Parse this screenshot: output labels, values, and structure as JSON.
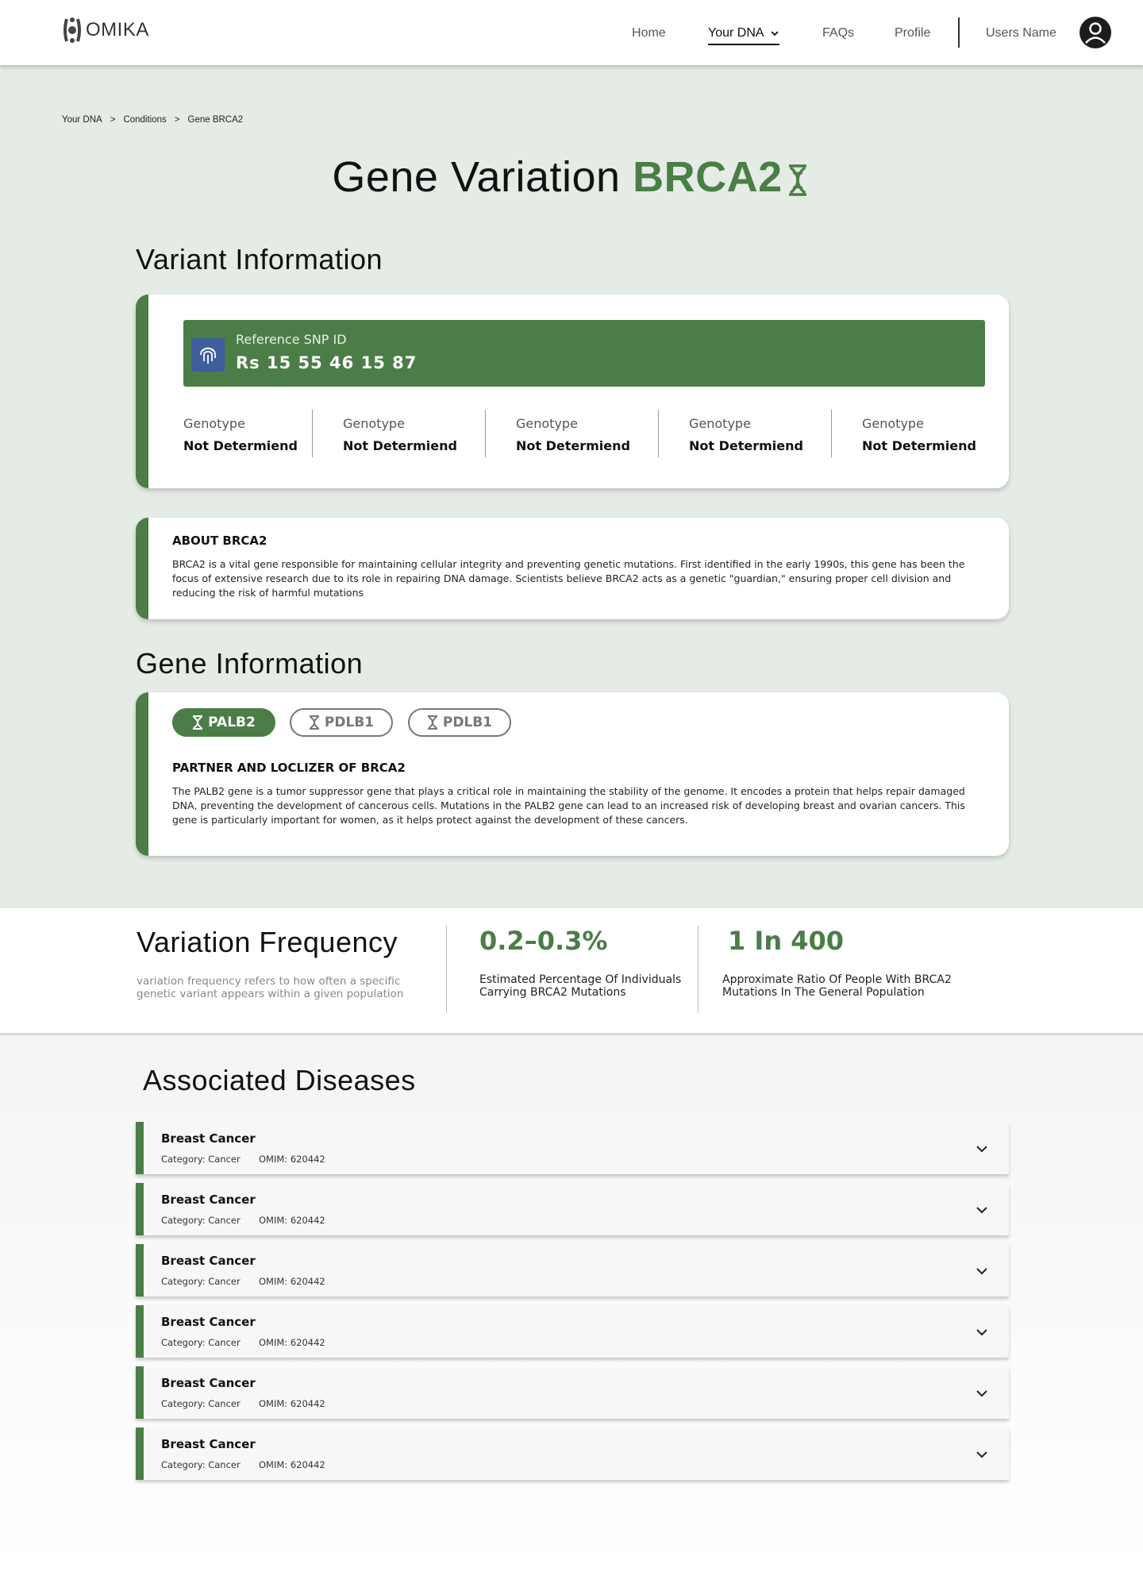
{
  "header": {
    "logo_text": "OMIKA",
    "nav": {
      "home": "Home",
      "your_dna": "Your DNA",
      "faqs": "FAQs",
      "profile": "Profile",
      "user_name": "Users Name"
    }
  },
  "breadcrumb": [
    "Your DNA",
    ">",
    "Conditions",
    ">",
    "Gene BRCA2"
  ],
  "title": {
    "prefix": "Gene Variation",
    "gene": "BRCA2"
  },
  "variant": {
    "heading": "Variant Information",
    "snp_label": "Reference SNP ID",
    "snp_value": "Rs 15 55 46 15 87",
    "genotypes": [
      {
        "label": "Genotype",
        "value": "Not Determiend"
      },
      {
        "label": "Genotype",
        "value": "Not Determiend"
      },
      {
        "label": "Genotype",
        "value": "Not Determiend"
      },
      {
        "label": "Genotype",
        "value": "Not Determiend"
      },
      {
        "label": "Genotype",
        "value": "Not Determiend"
      }
    ]
  },
  "about": {
    "title": "ABOUT BRCA2",
    "text": "BRCA2 is a vital gene responsible for maintaining cellular integrity and preventing genetic mutations. First identified in the early 1990s, this gene has been the focus of extensive research due to its role in repairing DNA damage. Scientists believe BRCA2 acts as a genetic \"guardian,\" ensuring proper cell division and reducing the risk of harmful mutations"
  },
  "gene_info": {
    "heading": "Gene Information",
    "tabs": [
      "PALB2",
      "PDLB1",
      "PDLB1"
    ],
    "active_tab": "PALB2",
    "title": "PARTNER AND LOCLIZER OF BRCA2",
    "text": "The PALB2 gene is a tumor suppressor gene that plays a critical role in maintaining the stability of the genome. It encodes a protein that helps repair damaged DNA, preventing the development of cancerous cells. Mutations in the PALB2 gene can lead to an increased risk of developing breast and ovarian cancers. This gene is particularly important for women, as it helps protect against the development of these cancers."
  },
  "frequency": {
    "heading": "Variation Frequency",
    "description": "variation frequency refers to how often a specific genetic variant appears within a given population",
    "stat1_value": "0.2–0.3%",
    "stat1_label": "Estimated Percentage Of Individuals Carrying BRCA2 Mutations",
    "stat2_value": "1 In 400",
    "stat2_label": "Approximate Ratio Of People With BRCA2 Mutations In The General Population"
  },
  "diseases": {
    "heading": "Associated Diseases",
    "items": [
      {
        "name": "Breast Cancer",
        "category": "Category: Cancer",
        "omim": "OMIM: 620442"
      },
      {
        "name": "Breast Cancer",
        "category": "Category: Cancer",
        "omim": "OMIM: 620442"
      },
      {
        "name": "Breast Cancer",
        "category": "Category: Cancer",
        "omim": "OMIM: 620442"
      },
      {
        "name": "Breast Cancer",
        "category": "Category: Cancer",
        "omim": "OMIM: 620442"
      },
      {
        "name": "Breast Cancer",
        "category": "Category: Cancer",
        "omim": "OMIM: 620442"
      },
      {
        "name": "Breast Cancer",
        "category": "Category: Cancer",
        "omim": "OMIM: 620442"
      }
    ]
  },
  "colors": {
    "accent": "#4b7d47",
    "snp_icon_bg": "#3f5e9e",
    "page_bg": "#e5ebe5"
  },
  "icons": [
    "omika-logo-icon",
    "chevron-down-icon",
    "user-avatar-icon",
    "dna-icon",
    "fingerprint-icon"
  ]
}
